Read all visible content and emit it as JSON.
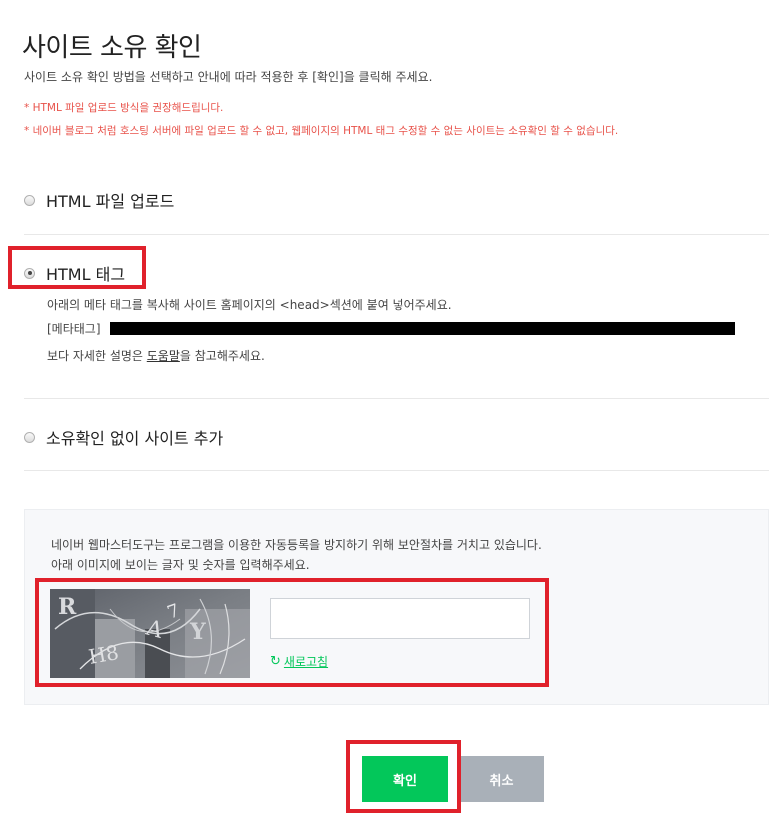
{
  "page": {
    "title": "사이트 소유 확인",
    "description": "사이트 소유 확인 방법을 선택하고 안내에 따라 적용한 후 [확인]을 클릭해 주세요.",
    "notes": [
      "* HTML 파일 업로드 방식을 권장해드립니다.",
      "* 네이버 블로그 처럼 호스팅 서버에 파일 업로드 할 수 없고, 웹페이지의 HTML 태그 수정할 수 없는 사이트는 소유확인 할 수 없습니다."
    ]
  },
  "options": [
    {
      "label": "HTML 파일 업로드",
      "checked": false
    },
    {
      "label": "HTML 태그",
      "checked": true
    },
    {
      "label": "소유확인 없이 사이트 추가",
      "checked": false
    }
  ],
  "html_tag": {
    "instruction": "아래의 메타 태그를 복사해 사이트 홈페이지의 <head>섹션에 붙여 넣어주세요.",
    "meta_label": "[메타태그]",
    "help_prefix": "보다 자세한 설명은 ",
    "help_link": "도움말",
    "help_suffix": "을 참고해주세요."
  },
  "captcha": {
    "line1": "네이버 웹마스터도구는 프로그램을 이용한 자동등록을 방지하기 위해 보안절차를 거치고 있습니다.",
    "line2": "아래 이미지에 보이는 글자 및 숫자를 입력해주세요.",
    "input_value": "",
    "refresh_label": "새로고침"
  },
  "buttons": {
    "confirm": "확인",
    "cancel": "취소"
  },
  "colors": {
    "accent": "#03c75a",
    "warning": "#e8524a",
    "highlight": "#e0212b",
    "cancel": "#a9b0b8"
  }
}
